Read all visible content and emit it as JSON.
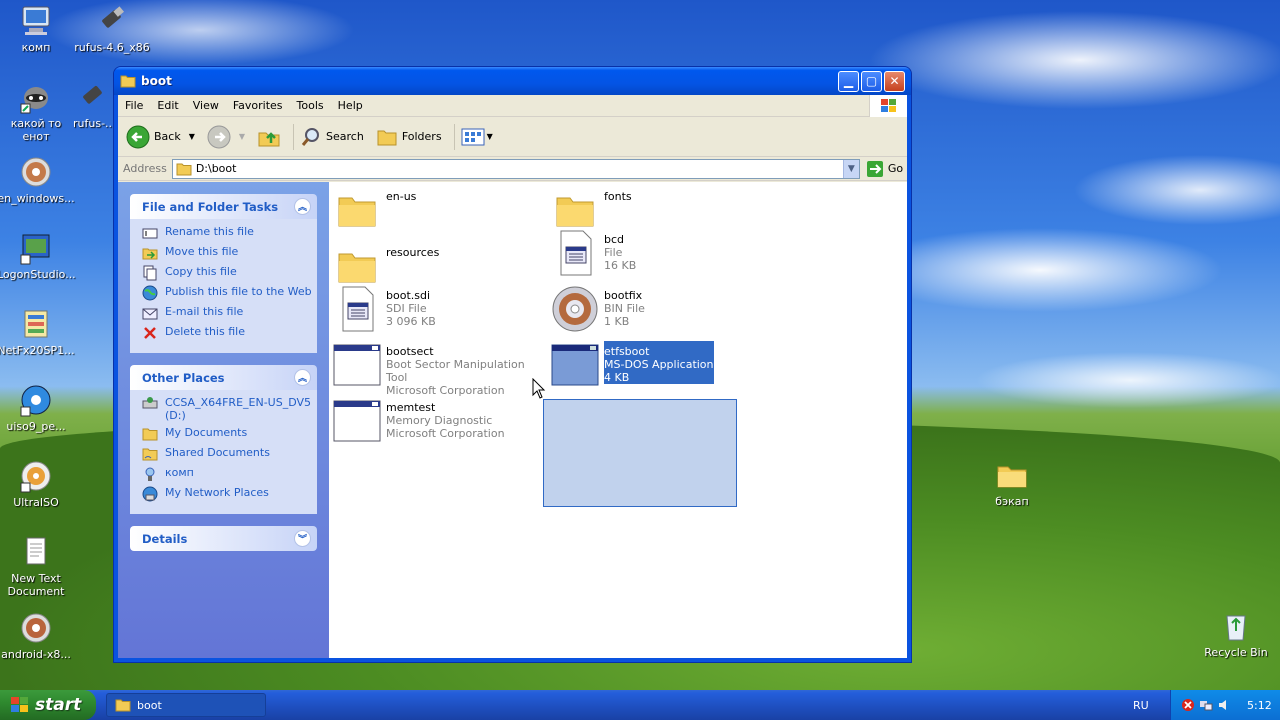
{
  "desktop": {
    "icons_left": [
      {
        "label": "комп",
        "icon": "computer-icon"
      },
      {
        "label": "какой то енот",
        "icon": "raccoon-shortcut-icon"
      },
      {
        "label": "en_windows...",
        "icon": "disc-image-icon"
      },
      {
        "label": "LogonStudio...",
        "icon": "app-shortcut-icon"
      },
      {
        "label": "NetFx20SP1...",
        "icon": "installer-icon"
      },
      {
        "label": "uiso9_pe...",
        "icon": "iso-installer-icon"
      },
      {
        "label": "UltraISO",
        "icon": "ultraiso-icon"
      },
      {
        "label": "New Text Document",
        "icon": "text-document-icon"
      },
      {
        "label": "android-x8...",
        "icon": "disc-image-icon"
      }
    ],
    "icons_second_col": [
      {
        "label": "rufus-4.6_x86",
        "icon": "usb-drive-icon"
      },
      {
        "label": "rufus-...",
        "icon": "usb-drive-icon"
      }
    ],
    "icons_right": [
      {
        "label": "бэкап",
        "icon": "folder-icon"
      },
      {
        "label": "Recycle Bin",
        "icon": "recycle-bin-icon"
      }
    ]
  },
  "window": {
    "title": "boot",
    "menu": [
      "File",
      "Edit",
      "View",
      "Favorites",
      "Tools",
      "Help"
    ],
    "toolbar": {
      "back": "Back",
      "search": "Search",
      "folders": "Folders"
    },
    "address": {
      "label": "Address",
      "value": "D:\\boot",
      "go": "Go"
    },
    "task_pane": {
      "file_tasks": {
        "title": "File and Folder Tasks",
        "items": [
          "Rename this file",
          "Move this file",
          "Copy this file",
          "Publish this file to the Web",
          "E-mail this file",
          "Delete this file"
        ]
      },
      "other_places": {
        "title": "Other Places",
        "items": [
          "CCSA_X64FRE_EN-US_DV5 (D:)",
          "My Documents",
          "Shared Documents",
          "комп",
          "My Network Places"
        ]
      },
      "details": {
        "title": "Details"
      }
    },
    "files": [
      {
        "name": "en-us",
        "type": "",
        "info": "",
        "icon": "folder-icon"
      },
      {
        "name": "fonts",
        "type": "",
        "info": "",
        "icon": "folder-icon"
      },
      {
        "name": "resources",
        "type": "",
        "info": "",
        "icon": "folder-icon"
      },
      {
        "name": "bcd",
        "type": "File",
        "info": "16 KB",
        "icon": "generic-file-icon"
      },
      {
        "name": "boot.sdi",
        "type": "SDI File",
        "info": "3 096 KB",
        "icon": "generic-file-icon"
      },
      {
        "name": "bootfix",
        "type": "BIN File",
        "info": "1 KB",
        "icon": "disc-file-icon"
      },
      {
        "name": "bootsect",
        "type": "Boot Sector Manipulation Tool",
        "info": "Microsoft Corporation",
        "icon": "application-icon"
      },
      {
        "name": "etfsboot",
        "type": "MS-DOS Application",
        "info": "4 KB",
        "icon": "application-icon",
        "selected": true
      },
      {
        "name": "memtest",
        "type": "Memory Diagnostic",
        "info": "Microsoft Corporation",
        "icon": "application-icon"
      }
    ]
  },
  "taskbar": {
    "start": "start",
    "task": "boot",
    "language": "RU",
    "clock": "5:12"
  },
  "colors": {
    "taskpane_link": "#215dc6",
    "selection": "#316ac5",
    "title_blue": "#0058ee",
    "start_green": "#2f8a2f"
  }
}
